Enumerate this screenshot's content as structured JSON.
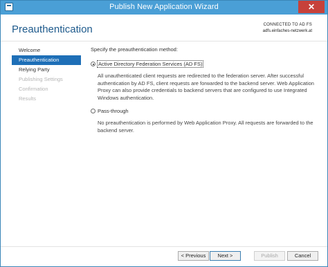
{
  "window": {
    "title": "Publish New Application Wizard",
    "close_glyph": "✕",
    "app_icon": "window-app-icon",
    "accent_color": "#4a9fd6",
    "close_color": "#c7413a"
  },
  "header": {
    "page_title": "Preauthentication",
    "connection_label": "CONNECTED TO AD FS",
    "connection_server": "adfs.einfaches-netzwerk.at"
  },
  "sidebar": {
    "items": [
      {
        "label": "Welcome",
        "state": "normal"
      },
      {
        "label": "Preauthentication",
        "state": "active"
      },
      {
        "label": "Relying Party",
        "state": "normal"
      },
      {
        "label": "Publishing Settings",
        "state": "disabled"
      },
      {
        "label": "Confirmation",
        "state": "disabled"
      },
      {
        "label": "Results",
        "state": "disabled"
      }
    ]
  },
  "main": {
    "prompt": "Specify the preauthentication method:",
    "options": [
      {
        "label": "Active Directory Federation Services (AD FS)",
        "checked": true,
        "description": "All unauthenticated client requests are redirected to the federation server. After successful authentication by AD FS, client requests are forwarded to the backend server. Web Application Proxy can also provide credentials to backend servers that are configured to use Integrated Windows authentication."
      },
      {
        "label": "Pass-through",
        "checked": false,
        "description": "No preauthentication is performed by Web Application Proxy. All requests are forwarded to the backend server."
      }
    ]
  },
  "footer": {
    "previous_label": "< Previous",
    "next_label": "Next >",
    "publish_label": "Publish",
    "cancel_label": "Cancel"
  }
}
